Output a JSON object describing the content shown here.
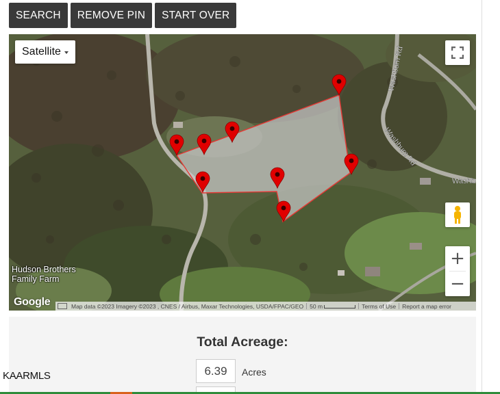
{
  "toolbar": {
    "search_label": "SEARCH",
    "remove_pin_label": "REMOVE PIN",
    "start_over_label": "START OVER"
  },
  "map": {
    "map_type": "Satellite",
    "icons": [
      "fullscreen-icon",
      "pegman-icon",
      "zoom-in-icon",
      "zoom-out-icon",
      "keyboard-icon",
      "map-pin-icon"
    ],
    "place_label_line1": "Hudson Brothers",
    "place_label_line2": "Family Farm",
    "road_label_1": "Washburn Rd",
    "road_label_2": "Washburn Rd",
    "road_label_3": "Washb",
    "google_logo": "Google",
    "zoom_in": "+",
    "zoom_out": "−",
    "attribution": {
      "map_data": "Map data ©2023 Imagery ©2023 , CNES / Airbus, Maxar Technologies, USDA/FPAC/GEO",
      "scale": "50 m",
      "terms": "Terms of Use",
      "report": "Report a map error"
    },
    "polygon_fill": "#c8c8c8",
    "polygon_stroke": "#e53935",
    "pin_color": "#e00000",
    "pin_count": 9
  },
  "acreage": {
    "title": "Total Acreage:",
    "value": "6.39",
    "unit": "Acres"
  },
  "brand": "KAARMLS",
  "colors": {
    "button_bg": "#3a3a3a",
    "panel_bg": "#f4f4f4",
    "bottom_bar": "#2e8b3a",
    "bottom_bar_accent": "#d9621c"
  }
}
